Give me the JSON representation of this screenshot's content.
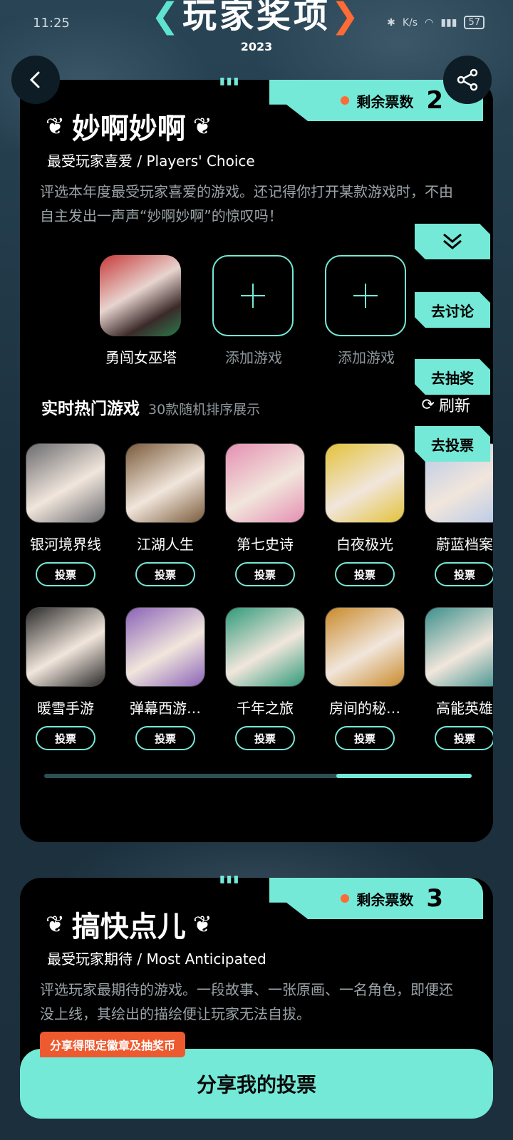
{
  "status_bar": {
    "time": "11:25",
    "network": "K/s",
    "battery": "57"
  },
  "header": {
    "title": "玩家奖项",
    "year": "2023"
  },
  "award1": {
    "tickets_label": "剩余票数",
    "tickets_count": "2",
    "title": "妙啊妙啊",
    "subtitle": "最受玩家喜爱 / Players' Choice",
    "description": "评选本年度最受玩家喜爱的游戏。还记得你打开某款游戏时，不由自主发出一声声“妙啊妙啊”的惊叹吗！",
    "picks": [
      {
        "label": "勇闯女巫塔",
        "filled": true
      },
      {
        "label": "添加游戏",
        "filled": false
      },
      {
        "label": "添加游戏",
        "filled": false
      }
    ],
    "hot_title": "实时热门游戏",
    "hot_sub": "30款随机排序展示",
    "refresh_label": "刷新",
    "vote_label": "投票",
    "games_row1": [
      {
        "name": "银河境界线",
        "color": "#6b6b70"
      },
      {
        "name": "江湖人生",
        "color": "#7a5b3b"
      },
      {
        "name": "第七史诗",
        "color": "#e58fb2"
      },
      {
        "name": "白夜极光",
        "color": "#e3c23a"
      },
      {
        "name": "蔚蓝档案",
        "color": "#b7c9e8"
      }
    ],
    "games_row2": [
      {
        "name": "暖雪手游",
        "color": "#2b2b2b"
      },
      {
        "name": "弹幕西游…",
        "color": "#8a63b8"
      },
      {
        "name": "千年之旅",
        "color": "#2f9a7a"
      },
      {
        "name": "房间的秘…",
        "color": "#c98a2b"
      },
      {
        "name": "高能英雄",
        "color": "#3c8f8c"
      }
    ]
  },
  "side_actions": {
    "expand": "",
    "discuss": "去讨论",
    "lottery": "去抽奖",
    "vote": "去投票"
  },
  "award2": {
    "tickets_label": "剩余票数",
    "tickets_count": "3",
    "title": "搞快点儿",
    "subtitle": "最受玩家期待 / Most Anticipated",
    "description": "评选玩家最期待的游戏。一段故事、一张原画、一名角色，即便还没上线，其绘出的描绘便让玩家无法自拔。"
  },
  "share": {
    "badge": "分享得限定徽章及抽奖币",
    "button": "分享我的投票"
  },
  "colors": {
    "accent": "#74e9d7",
    "orange": "#ff6b35"
  }
}
